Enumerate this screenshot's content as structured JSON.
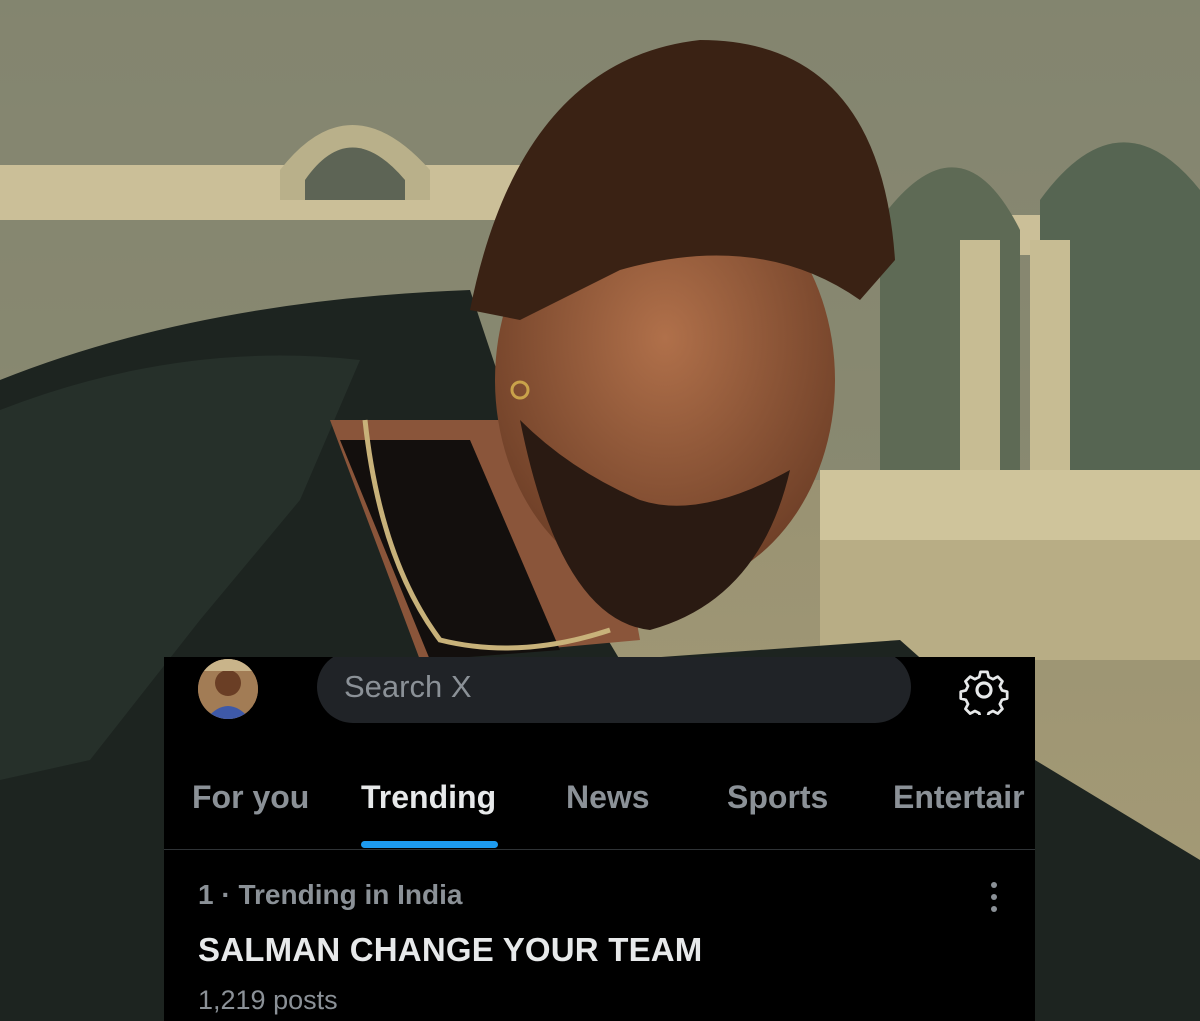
{
  "search": {
    "placeholder": "Search X"
  },
  "tabs": [
    {
      "label": "For you",
      "active": false
    },
    {
      "label": "Trending",
      "active": true
    },
    {
      "label": "News",
      "active": false
    },
    {
      "label": "Sports",
      "active": false
    },
    {
      "label": "Entertair",
      "active": false
    }
  ],
  "trend": {
    "rank_context": "1 · Trending in India",
    "title": "SALMAN CHANGE YOUR TEAM",
    "post_count": "1,219 posts"
  },
  "icons": {
    "settings": "gear-icon",
    "more": "more-vertical-icon"
  },
  "colors": {
    "accent": "#1d9bf0",
    "panel_bg": "#000000",
    "search_bg": "#202327",
    "muted_text": "#8b9197"
  }
}
